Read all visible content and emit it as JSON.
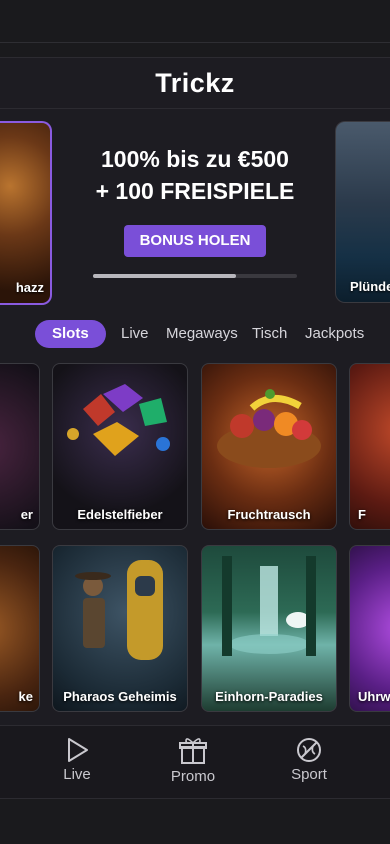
{
  "app": {
    "title": "Trickz"
  },
  "banner": {
    "left_game": "Drachenschatz",
    "left_game_visible": "hazz",
    "right_game_visible": "Plünde",
    "promo_line1": "100% bis zu €500",
    "promo_line2": "+ 100 FREISPIELE",
    "button_label": "BONUS HOLEN",
    "progress": 0.7
  },
  "tabs": [
    {
      "label": "Slots",
      "active": true
    },
    {
      "label": "Live",
      "active": false
    },
    {
      "label": "Megaways",
      "active": false
    },
    {
      "label": "Tisch",
      "active": false
    },
    {
      "label": "Jackpots",
      "active": false
    }
  ],
  "games_row1": [
    {
      "label": "er"
    },
    {
      "label": "Edelstelfieber"
    },
    {
      "label": "Fruchtrausch"
    },
    {
      "label": "F"
    }
  ],
  "games_row2": [
    {
      "label": "ke"
    },
    {
      "label": "Pharaos Geheimis"
    },
    {
      "label": "Einhorn-Paradies"
    },
    {
      "label": "Uhrw"
    }
  ],
  "nav": [
    {
      "label": "Live",
      "icon": "play-icon"
    },
    {
      "label": "Promo",
      "icon": "gift-icon"
    },
    {
      "label": "Sport",
      "icon": "ball-icon"
    }
  ],
  "colors": {
    "accent": "#7a4fd8",
    "background": "#1d1c22"
  }
}
